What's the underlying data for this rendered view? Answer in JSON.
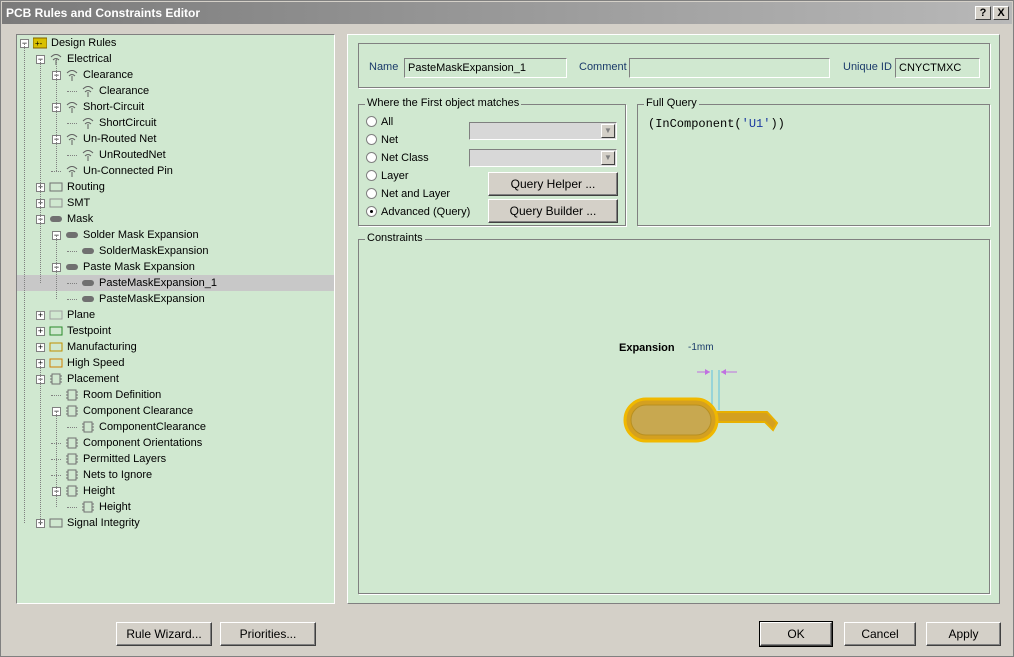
{
  "window": {
    "title": "PCB Rules and Constraints Editor",
    "help_btn": "?",
    "close_btn": "X"
  },
  "tree": [
    {
      "label": "Design Rules",
      "depth": 0,
      "exp": "−",
      "icon": "design-rules-icon",
      "row": 0
    },
    {
      "label": "Electrical",
      "depth": 1,
      "exp": "−",
      "icon": "electrical-icon",
      "row": 1
    },
    {
      "label": "Clearance",
      "depth": 2,
      "exp": "−",
      "icon": "electrical-icon",
      "row": 2
    },
    {
      "label": "Clearance",
      "depth": 3,
      "exp": "",
      "icon": "electrical-icon",
      "row": 3
    },
    {
      "label": "Short-Circuit",
      "depth": 2,
      "exp": "−",
      "icon": "electrical-icon",
      "row": 4
    },
    {
      "label": "ShortCircuit",
      "depth": 3,
      "exp": "",
      "icon": "electrical-icon",
      "row": 5
    },
    {
      "label": "Un-Routed Net",
      "depth": 2,
      "exp": "−",
      "icon": "electrical-icon",
      "row": 6
    },
    {
      "label": "UnRoutedNet",
      "depth": 3,
      "exp": "",
      "icon": "electrical-icon",
      "row": 7
    },
    {
      "label": "Un-Connected Pin",
      "depth": 2,
      "exp": "",
      "icon": "electrical-icon",
      "row": 8
    },
    {
      "label": "Routing",
      "depth": 1,
      "exp": "+",
      "icon": "routing-icon",
      "row": 9
    },
    {
      "label": "SMT",
      "depth": 1,
      "exp": "+",
      "icon": "smt-icon",
      "row": 10
    },
    {
      "label": "Mask",
      "depth": 1,
      "exp": "−",
      "icon": "mask-icon",
      "row": 11
    },
    {
      "label": "Solder Mask Expansion",
      "depth": 2,
      "exp": "−",
      "icon": "mask-icon",
      "row": 12
    },
    {
      "label": "SolderMaskExpansion",
      "depth": 3,
      "exp": "",
      "icon": "mask-icon",
      "row": 13
    },
    {
      "label": "Paste Mask Expansion",
      "depth": 2,
      "exp": "−",
      "icon": "mask-icon",
      "row": 14
    },
    {
      "label": "PasteMaskExpansion_1",
      "depth": 3,
      "exp": "",
      "icon": "mask-icon",
      "row": 15,
      "selected": true
    },
    {
      "label": "PasteMaskExpansion",
      "depth": 3,
      "exp": "",
      "icon": "mask-icon",
      "row": 16
    },
    {
      "label": "Plane",
      "depth": 1,
      "exp": "+",
      "icon": "plane-icon",
      "row": 17
    },
    {
      "label": "Testpoint",
      "depth": 1,
      "exp": "+",
      "icon": "testpoint-icon",
      "row": 18
    },
    {
      "label": "Manufacturing",
      "depth": 1,
      "exp": "+",
      "icon": "manufacturing-icon",
      "row": 19
    },
    {
      "label": "High Speed",
      "depth": 1,
      "exp": "+",
      "icon": "high-speed-icon",
      "row": 20
    },
    {
      "label": "Placement",
      "depth": 1,
      "exp": "−",
      "icon": "placement-icon",
      "row": 21
    },
    {
      "label": "Room Definition",
      "depth": 2,
      "exp": "",
      "icon": "placement-icon",
      "row": 22
    },
    {
      "label": "Component Clearance",
      "depth": 2,
      "exp": "−",
      "icon": "placement-icon",
      "row": 23
    },
    {
      "label": "ComponentClearance",
      "depth": 3,
      "exp": "",
      "icon": "placement-icon",
      "row": 24
    },
    {
      "label": "Component Orientations",
      "depth": 2,
      "exp": "",
      "icon": "placement-icon",
      "row": 25
    },
    {
      "label": "Permitted Layers",
      "depth": 2,
      "exp": "",
      "icon": "placement-icon",
      "row": 26
    },
    {
      "label": "Nets to Ignore",
      "depth": 2,
      "exp": "",
      "icon": "placement-icon",
      "row": 27
    },
    {
      "label": "Height",
      "depth": 2,
      "exp": "−",
      "icon": "placement-icon",
      "row": 28
    },
    {
      "label": "Height",
      "depth": 3,
      "exp": "",
      "icon": "placement-icon",
      "row": 29
    },
    {
      "label": "Signal Integrity",
      "depth": 1,
      "exp": "+",
      "icon": "signal-integrity-icon",
      "row": 30
    }
  ],
  "header": {
    "name_label": "Name",
    "name_value": "PasteMaskExpansion_1",
    "comment_label": "Comment",
    "comment_value": "",
    "uid_label": "Unique ID",
    "uid_value": "CNYCTMXC"
  },
  "match": {
    "title": "Where the First object matches",
    "options": [
      {
        "label": "All",
        "selected": false
      },
      {
        "label": "Net",
        "selected": false
      },
      {
        "label": "Net Class",
        "selected": false
      },
      {
        "label": "Layer",
        "selected": false
      },
      {
        "label": "Net and Layer",
        "selected": false
      },
      {
        "label": "Advanced (Query)",
        "selected": true
      }
    ],
    "query_helper": "Query Helper ...",
    "query_builder": "Query Builder ..."
  },
  "full_query": {
    "title": "Full Query",
    "prefix": "(InComponent(",
    "arg": "'U1'",
    "suffix": "))"
  },
  "constraints": {
    "title": "Constraints",
    "expansion_label": "Expansion",
    "expansion_value": "-1mm"
  },
  "footer": {
    "rule_wizard": "Rule Wizard...",
    "priorities": "Priorities...",
    "ok": "OK",
    "cancel": "Cancel",
    "apply": "Apply"
  },
  "colors": {
    "panel_bg": "#d0e8d0",
    "pad_fill": "#d4a020",
    "pad_stroke": "#e8b000",
    "dim_color": "#c070e0"
  }
}
